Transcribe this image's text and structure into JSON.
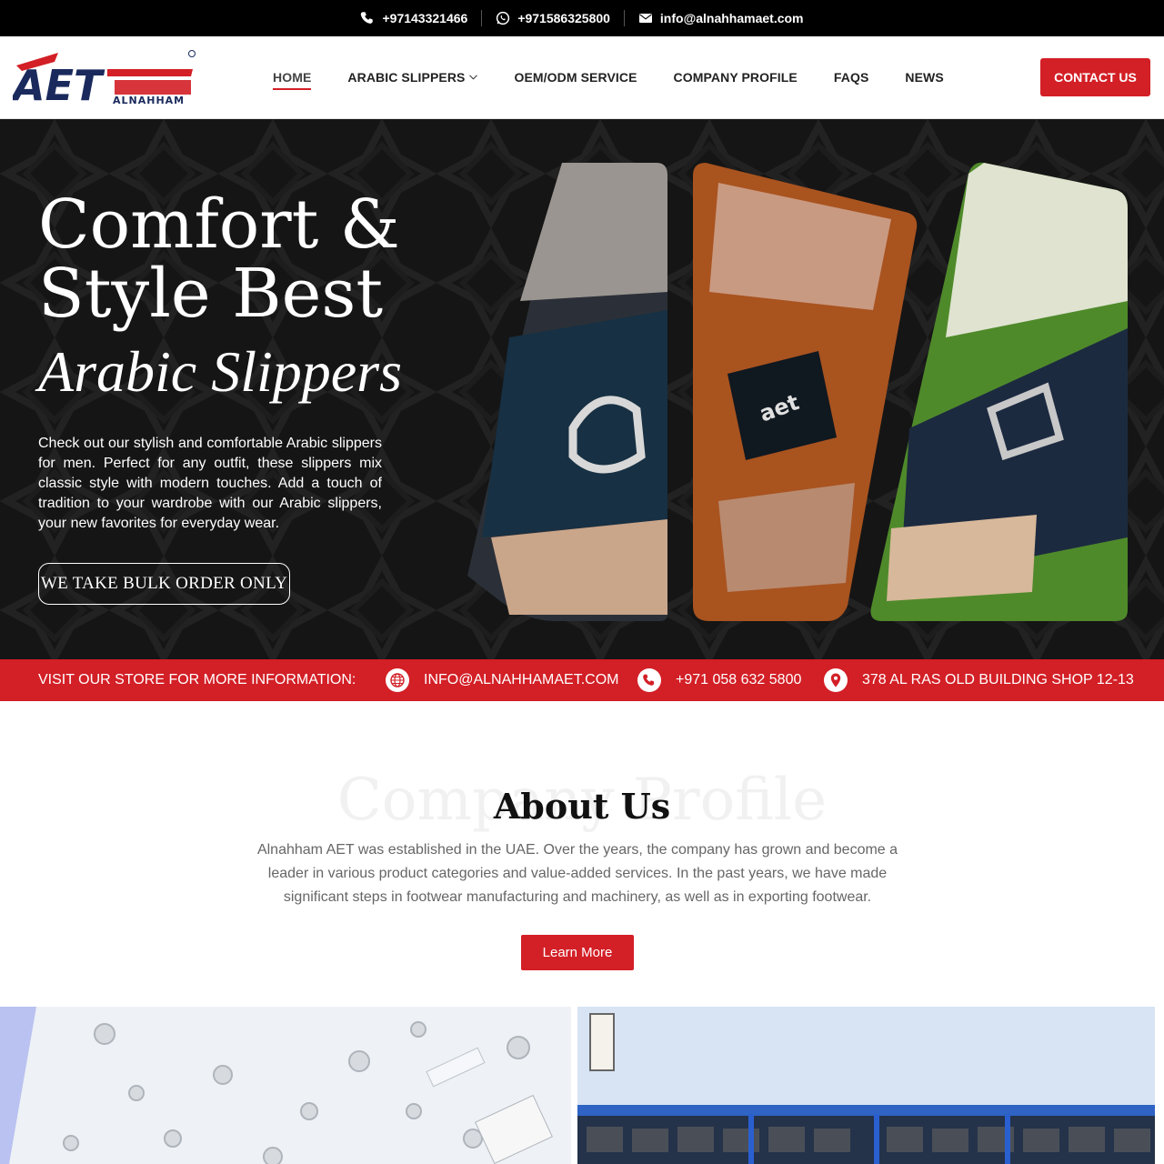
{
  "topbar": {
    "phone": "+97143321466",
    "whatsapp": "+971586325800",
    "email": "info@alnahhamaet.com"
  },
  "header": {
    "logo_text_latin": "AET",
    "logo_text_sub": "ALNAHHAM",
    "nav": [
      {
        "label": "HOME",
        "active": true
      },
      {
        "label": "ARABIC SLIPPERS",
        "dropdown": true
      },
      {
        "label": "OEM/ODM SERVICE"
      },
      {
        "label": "COMPANY PROFILE"
      },
      {
        "label": "FAQS"
      },
      {
        "label": "NEWS"
      }
    ],
    "contact_label": "CONTACT US"
  },
  "hero": {
    "title_line1": "Comfort &",
    "title_line2": "Style Best",
    "script": "Arabic Slippers",
    "description": "Check out our stylish and comfortable Arabic slippers for men. Perfect for any outfit, these slippers mix classic style with modern touches. Add a touch of tradition to your wardrobe with our Arabic slippers, your new favorites for everyday wear.",
    "button_label": "WE TAKE BULK ORDER ONLY"
  },
  "strip": {
    "lead": "VISIT OUR STORE FOR MORE INFORMATION:",
    "email": "INFO@ALNAHHAMAET.COM",
    "phone": "+971 058 632 5800",
    "address": "378 AL RAS OLD BUILDING SHOP 12-13"
  },
  "about": {
    "bg_text": "Company Profile",
    "title": "About Us",
    "description": "Alnahham AET was established in the UAE. Over the years, the company has grown and become a leader in various product categories and value-added services. In the past years, we have made significant steps in footwear manufacturing and machinery, as well as in exporting footwear.",
    "button_label": "Learn More"
  },
  "colors": {
    "brand_red": "#d31f26",
    "topbar_bg": "#000000",
    "hero_bg": "#151515",
    "logo_navy": "#1a2a5c"
  }
}
